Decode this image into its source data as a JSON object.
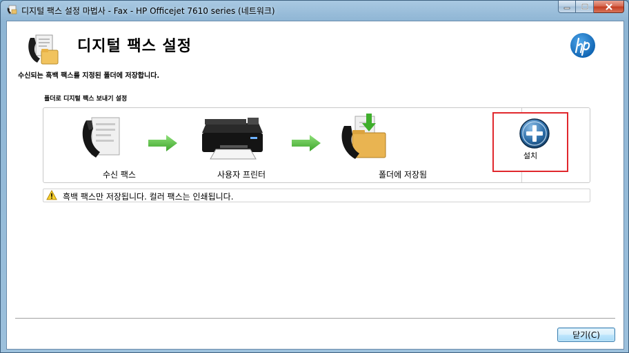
{
  "window": {
    "title": "디지털 팩스 설정 마법사 - Fax - HP Officejet 7610 series (네트워크)"
  },
  "header": {
    "title": "디지털 팩스 설정",
    "description": "수신되는 흑백 팩스를 지정된 폴더에 저장합니다."
  },
  "flow": {
    "group_label": "폴더로 디지털 팩스 보내기 설정",
    "steps": [
      {
        "label": "수신 팩스",
        "icon": "incoming-fax-icon"
      },
      {
        "label": "사용자 프린터",
        "icon": "printer-icon"
      },
      {
        "label": "폴더에 저장됨",
        "icon": "folder-save-icon"
      }
    ],
    "setup_label": "설치"
  },
  "warning": {
    "text": "흑백 팩스만 저장됩니다. 컬러 팩스는 인쇄됩니다."
  },
  "footer": {
    "close_label": "닫기(C)"
  },
  "colors": {
    "highlight_border": "#e0262b",
    "arrow_green": "#5cc34a",
    "hp_blue": "#0a6fc2"
  }
}
